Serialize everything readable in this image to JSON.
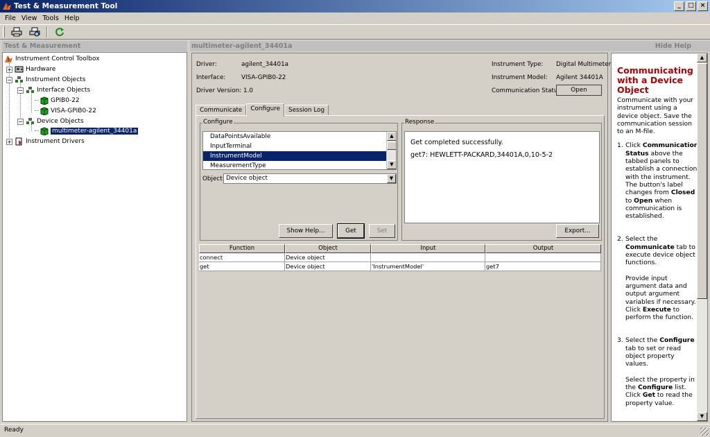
{
  "window": {
    "title": "Test & Measurement Tool",
    "min": "_",
    "max": "□",
    "close": "×"
  },
  "menu": [
    "File",
    "View",
    "Tools",
    "Help"
  ],
  "left_panel": {
    "header": "Test & Measurement",
    "tree": {
      "root": "Instrument Control Toolbox",
      "hardware": "Hardware",
      "instrument_objects": "Instrument Objects",
      "interface_objects": "Interface Objects",
      "gpib": "GPIB0-22",
      "visa": "VISA-GPIB0-22",
      "device_objects": "Device Objects",
      "device": "multimeter-agilent_34401a",
      "instrument_drivers": "Instrument Drivers"
    }
  },
  "right_header": {
    "title": "multimeter-agilent_34401a",
    "hide_help": "Hide Help"
  },
  "info": {
    "driver_label": "Driver:",
    "driver_value": "agilent_34401a",
    "interface_label": "Interface:",
    "interface_value": "VISA-GPIB0-22",
    "driver_version": "Driver Version: 1.0",
    "type_label": "Instrument Type:",
    "type_value": "Digital Multimeter",
    "model_label": "Instrument Model:",
    "model_value": "Agilent 34401A",
    "comm_label": "Communication Status:",
    "comm_value": "Open"
  },
  "tabs": [
    "Communicate",
    "Configure",
    "Session Log"
  ],
  "configure": {
    "title": "Configure",
    "properties": [
      "DataPointsAvailable",
      "InputTerminal",
      "InstrumentModel",
      "MeasurementType"
    ],
    "object_label": "Object:",
    "object_value": "Device object",
    "show_help": "Show Help...",
    "get": "Get",
    "set": "Set"
  },
  "response": {
    "title": "Response",
    "line1": "Get completed successfully.",
    "line2": "get7: HEWLETT-PACKARD,34401A,0,10-5-2",
    "export": "Export..."
  },
  "table": {
    "headers": [
      "Function",
      "Object",
      "Input",
      "Output"
    ],
    "rows": [
      [
        "connect",
        "Device object",
        "",
        ""
      ],
      [
        "get",
        "Device object",
        "'InstrumentModel'",
        "get7"
      ]
    ]
  },
  "help": {
    "title": "Communicating with a Device Object",
    "intro": "Communicate with your instrument using a device object. Save the communication session to an M-file.",
    "s1_num": "1.",
    "s1_a": "Click",
    "s1_b": "Communication Status",
    "s1_c": "above the tabbed panels to establish a connection with the instrument. The button's label changes from",
    "s1_d": "Closed",
    "s1_e": "to",
    "s1_f": "Open",
    "s1_g": "when communication is established.",
    "s2_num": "2.",
    "s2_a": "Select the",
    "s2_b": "Communicate",
    "s2_c": "tab to execute device object functions.",
    "s2_p2a": "Provide input argument data and output argument variables if necessary. Click",
    "s2_p2b": "Execute",
    "s2_p2c": "to perform the function.",
    "s3_num": "3.",
    "s3_a": "Select the",
    "s3_b": "Configure",
    "s3_c": "tab to set or read object property values.",
    "s3_p2a": "Select the property in the",
    "s3_p2b": "Configure",
    "s3_p2c": "list. Click",
    "s3_p2d": "Get",
    "s3_p2e": "to read the property value."
  },
  "status": "Ready"
}
